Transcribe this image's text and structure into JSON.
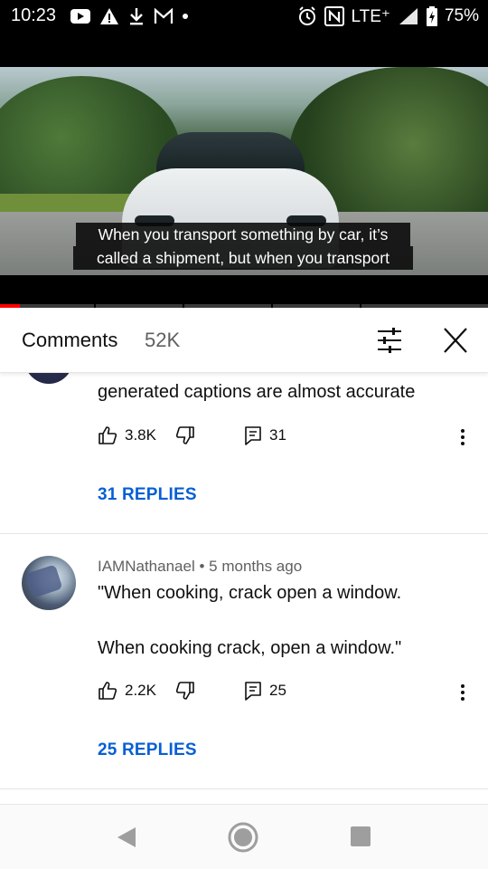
{
  "status_bar": {
    "time": "10:23",
    "network": "LTE⁺",
    "battery": "75%",
    "left_icons": [
      "youtube-icon",
      "alert-icon",
      "download-icon",
      "gmail-icon",
      "dot-icon"
    ],
    "right_icons": [
      "alarm-icon",
      "nfc-icon",
      "signal-icon",
      "battery-icon"
    ]
  },
  "video": {
    "caption_line1": "When you transport something by car, it’s",
    "caption_line2": "called a shipment, but when you transport",
    "progress": 0.04,
    "colors": {
      "progress": "#ff0000"
    }
  },
  "comments_header": {
    "title": "Comments",
    "count": "52K",
    "filter_icon": "filter-sliders-icon",
    "close_icon": "close-icon"
  },
  "comments": [
    {
      "text": "generated captions are almost accurate",
      "likes": "3.8K",
      "reply_count": "31",
      "replies_label": "31 REPLIES"
    },
    {
      "author": "IAMNathanael",
      "separator": "•",
      "time": "5 months ago",
      "text_line1": "\"When cooking, crack open a window.",
      "text_line2": "When cooking crack, open a window.\"",
      "likes": "2.2K",
      "reply_count": "25",
      "replies_label": "25 REPLIES"
    }
  ],
  "colors": {
    "link": "#065fd4",
    "text": "#0f0f0f",
    "secondary": "#606060"
  },
  "nav_bar": {
    "icons": [
      "back-icon",
      "home-icon",
      "recents-icon"
    ]
  }
}
